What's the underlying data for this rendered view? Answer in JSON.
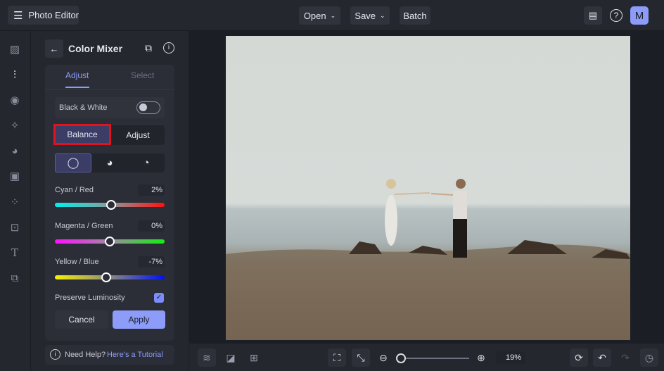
{
  "topbar": {
    "title": "Photo Editor",
    "open": "Open",
    "save": "Save",
    "batch": "Batch",
    "avatar": "M"
  },
  "panel": {
    "title": "Color Mixer",
    "tabs": [
      "Adjust",
      "Select"
    ],
    "bw_label": "Black & White",
    "bw_on": false,
    "modes": [
      "Balance",
      "Adjust"
    ],
    "sliders": [
      {
        "label": "Cyan / Red",
        "value": "2%",
        "fraction": 0.51
      },
      {
        "label": "Magenta / Green",
        "value": "0%",
        "fraction": 0.5
      },
      {
        "label": "Yellow / Blue",
        "value": "-7%",
        "fraction": 0.465
      }
    ],
    "preserve": "Preserve Luminosity",
    "preserve_checked": true,
    "cancel": "Cancel",
    "apply": "Apply",
    "help": "Need Help?",
    "help_link": "Here's a Tutorial"
  },
  "bottom": {
    "zoom": "19%"
  },
  "colors": {
    "accent": "#7c8cf8",
    "highlight": "#e0141e"
  }
}
